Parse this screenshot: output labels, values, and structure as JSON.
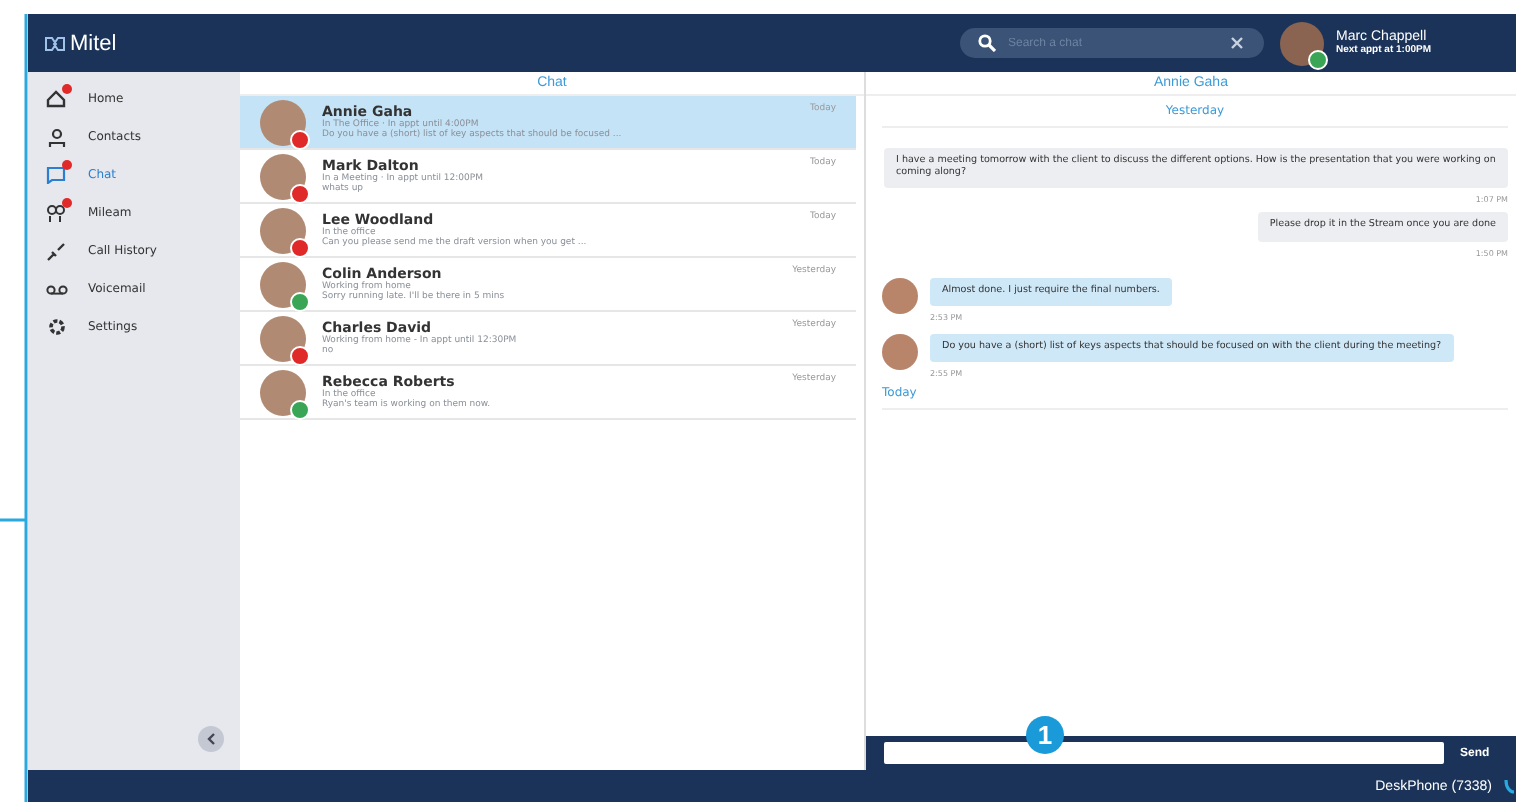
{
  "header": {
    "logo": "Mitel",
    "search": {
      "placeholder": "Search a chat"
    },
    "user": {
      "name": "Marc Chappell",
      "status": "Next appt at 1:00PM"
    }
  },
  "sidebar": {
    "items": [
      {
        "label": "Home",
        "selected": false,
        "badge": true
      },
      {
        "label": "Contacts",
        "selected": false,
        "badge": false
      },
      {
        "label": "Chat",
        "selected": true,
        "badge": true
      },
      {
        "label": "Mileam",
        "selected": false,
        "badge": true
      },
      {
        "label": "Call History",
        "selected": false,
        "badge": false
      },
      {
        "label": "Voicemail",
        "selected": false,
        "badge": false
      },
      {
        "label": "Settings",
        "selected": false,
        "badge": false
      }
    ]
  },
  "chat_list": {
    "title": "Chat",
    "items": [
      {
        "name": "Annie Gaha",
        "status": "In The Office · In appt until 4:00PM",
        "preview": "Do you have a (short) list of key aspects that should be focused ...",
        "time": "Today",
        "selected": true,
        "color": "#e02a2a"
      },
      {
        "name": "Mark Dalton",
        "status": "In a Meeting · In appt until 12:00PM",
        "preview": "whats up",
        "time": "Today",
        "selected": false,
        "color": "#e02a2a"
      },
      {
        "name": "Lee Woodland",
        "status": "In the office",
        "preview": "Can you please send me the draft version when you get ...",
        "time": "Today",
        "selected": false,
        "color": "#e02a2a"
      },
      {
        "name": "Colin Anderson",
        "status": "Working from home",
        "preview": "Sorry running late. I'll be there in 5 mins",
        "time": "Yesterday",
        "selected": false,
        "color": "#3aa655"
      },
      {
        "name": "Charles David",
        "status": "Working from home - In appt until 12:30PM",
        "preview": "no",
        "time": "Yesterday",
        "selected": false,
        "color": "#e02a2a"
      },
      {
        "name": "Rebecca Roberts",
        "status": "In the office",
        "preview": "Ryan's team is working on them now.",
        "time": "Yesterday",
        "selected": false,
        "color": "#3aa655"
      }
    ]
  },
  "conversation": {
    "title": "Annie Gaha",
    "entries": [
      {
        "kind": "date",
        "text": "Yesterday"
      },
      {
        "kind": "sent",
        "text": "I have a meeting tomorrow with the client to discuss the different options. How is the presentation that you were working on coming along?",
        "time": "1:07 PM"
      },
      {
        "kind": "sent",
        "text": "Please drop it in the Stream once you are done",
        "time": "1:50 PM"
      },
      {
        "kind": "received",
        "text": "Almost done. I just require the final numbers.",
        "time": "2:53 PM"
      },
      {
        "kind": "received",
        "text": "Do you have a (short) list of keys aspects that should be focused on with the client during the meeting?",
        "time": "2:55 PM"
      },
      {
        "kind": "date",
        "text": "Today"
      }
    ],
    "send_label": "Send"
  },
  "callout": "1",
  "status_bar": {
    "device": "DeskPhone (7338)"
  }
}
